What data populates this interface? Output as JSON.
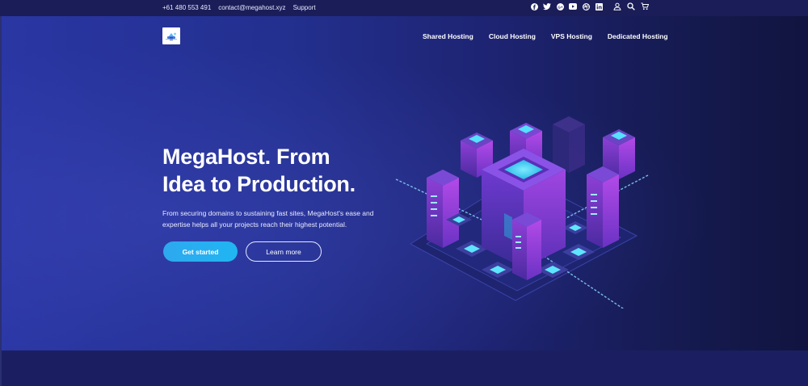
{
  "topbar": {
    "phone": "+61 480 553 491",
    "email": "contact@megahost.xyz",
    "support": "Support",
    "social_icons": [
      "facebook-icon",
      "twitter-icon",
      "google-plus-icon",
      "youtube-icon",
      "dribbble-icon",
      "linkedin-icon"
    ],
    "utility_icons": [
      "user-icon",
      "search-icon",
      "cart-icon"
    ]
  },
  "nav": {
    "items": [
      "Shared Hosting",
      "Cloud Hosting",
      "VPS Hosting",
      "Dedicated Hosting"
    ]
  },
  "hero": {
    "headline_line1": "MegaHost. From",
    "headline_line2": "Idea to Production.",
    "subtext": "From securing domains to sustaining fast sites, MegaHost's ease and expertise helps all your projects reach their highest potential.",
    "primary_button": "Get started",
    "secondary_button": "Learn more"
  },
  "colors": {
    "topbar_bg": "#1a1d58",
    "hero_left": "#2a36a3",
    "hero_right": "#11143f",
    "primary_button": "#2ea8f0",
    "accent_cyan": "#37e3ff",
    "accent_purple": "#b13df0"
  }
}
